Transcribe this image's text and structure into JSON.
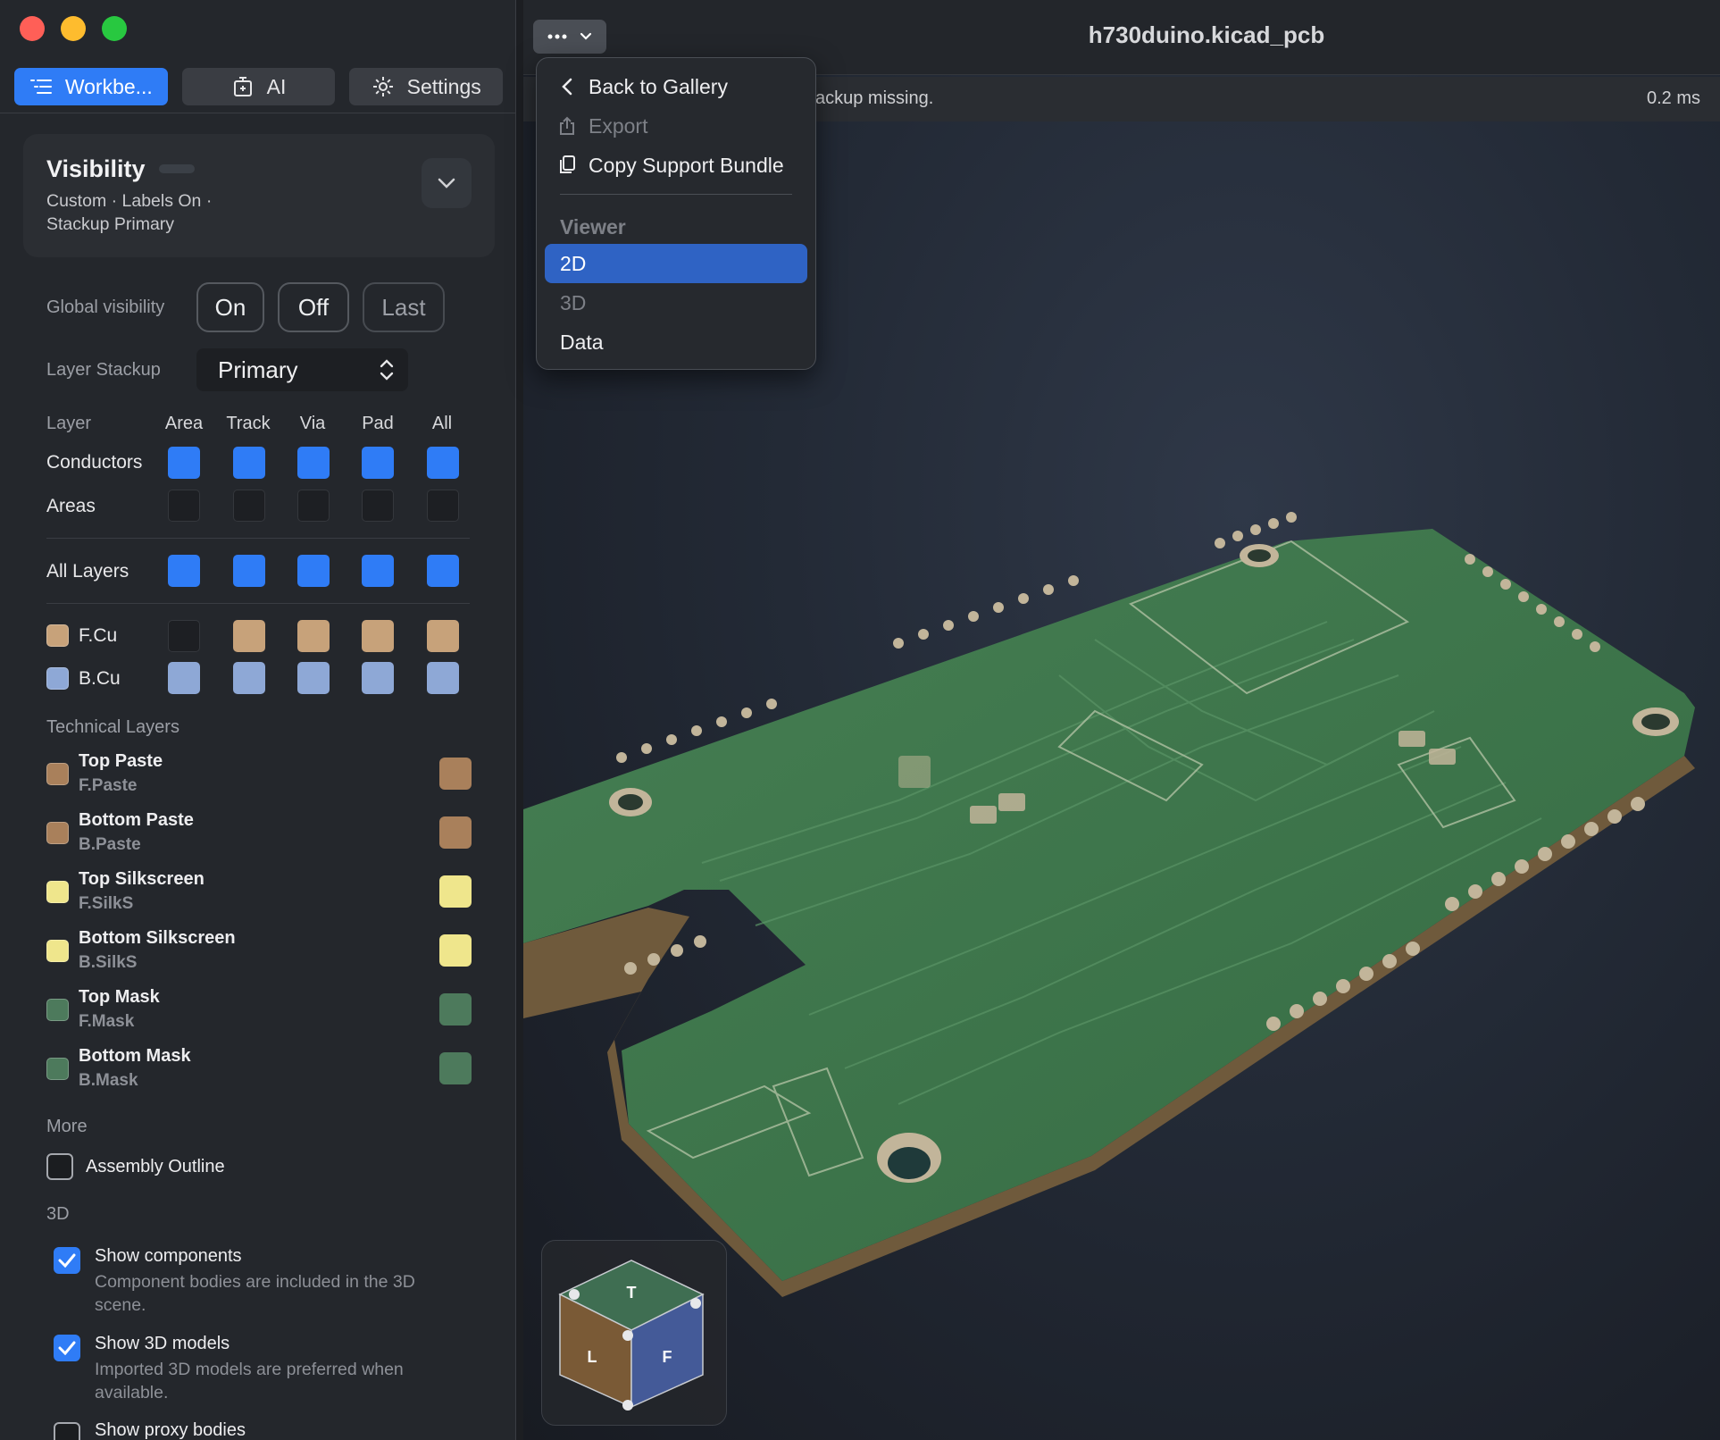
{
  "sidebar": {
    "tabs": [
      {
        "label": "Workbe...",
        "icon": "list-icon",
        "active": true
      },
      {
        "label": "AI",
        "icon": "ai-chat-icon",
        "active": false
      },
      {
        "label": "Settings",
        "icon": "gear-icon",
        "active": false
      }
    ],
    "visibility": {
      "title": "Visibility",
      "summary": "Custom · Labels On · Stackup Primary"
    },
    "global_visibility": {
      "label": "Global visibility",
      "buttons": [
        "On",
        "Off",
        "Last"
      ]
    },
    "layer_stackup": {
      "label": "Layer Stackup",
      "value": "Primary"
    },
    "layer_grid": {
      "columns": [
        "Layer",
        "Area",
        "Track",
        "Via",
        "Pad",
        "All"
      ],
      "rows": [
        {
          "label": "Conductors"
        },
        {
          "label": "Areas"
        },
        {
          "label": "All Layers"
        },
        {
          "label": "F.Cu",
          "color": "#c7a27a"
        },
        {
          "label": "B.Cu",
          "color": "#8ea8d6"
        }
      ]
    },
    "technical_layers": {
      "heading": "Technical Layers",
      "items": [
        {
          "name": "Top Paste",
          "id": "F.Paste",
          "color": "#a9805b"
        },
        {
          "name": "Bottom Paste",
          "id": "B.Paste",
          "color": "#a9805b"
        },
        {
          "name": "Top Silkscreen",
          "id": "F.SilkS",
          "color": "#efe68c"
        },
        {
          "name": "Bottom Silkscreen",
          "id": "B.SilkS",
          "color": "#efe68c"
        },
        {
          "name": "Top Mask",
          "id": "F.Mask",
          "color": "#4d7a5c"
        },
        {
          "name": "Bottom Mask",
          "id": "B.Mask",
          "color": "#4d7a5c"
        }
      ]
    },
    "more": {
      "heading": "More",
      "items": [
        {
          "label": "Assembly Outline",
          "checked": false
        }
      ]
    },
    "three_d": {
      "heading": "3D",
      "options": [
        {
          "title": "Show components",
          "desc": "Component bodies are included in the 3D scene.",
          "checked": true
        },
        {
          "title": "Show 3D models",
          "desc": "Imported 3D models are preferred when available.",
          "checked": true
        },
        {
          "title": "Show proxy bodies",
          "checked": false
        }
      ]
    }
  },
  "main": {
    "window_title": "h730duino.kicad_pcb",
    "status_message": "ackup missing.",
    "status_time": "0.2 ms",
    "nav_cube": {
      "top": "T",
      "left": "L",
      "front": "F"
    }
  },
  "menu": {
    "items": [
      {
        "label": "Back to Gallery",
        "icon": "chevron-left-icon",
        "enabled": true
      },
      {
        "label": "Export",
        "icon": "share-icon",
        "enabled": false
      },
      {
        "label": "Copy Support Bundle",
        "icon": "copy-document-icon",
        "enabled": true
      }
    ],
    "viewer_heading": "Viewer",
    "viewer_options": [
      {
        "label": "2D",
        "selected": true,
        "enabled": true
      },
      {
        "label": "3D",
        "selected": false,
        "enabled": false
      },
      {
        "label": "Data",
        "selected": false,
        "enabled": true
      }
    ]
  },
  "colors": {
    "accent": "#2f7cf6",
    "menu_selection": "#2f63c4",
    "pcb_green": "#3f7a4e",
    "copper": "#c7a27a"
  }
}
